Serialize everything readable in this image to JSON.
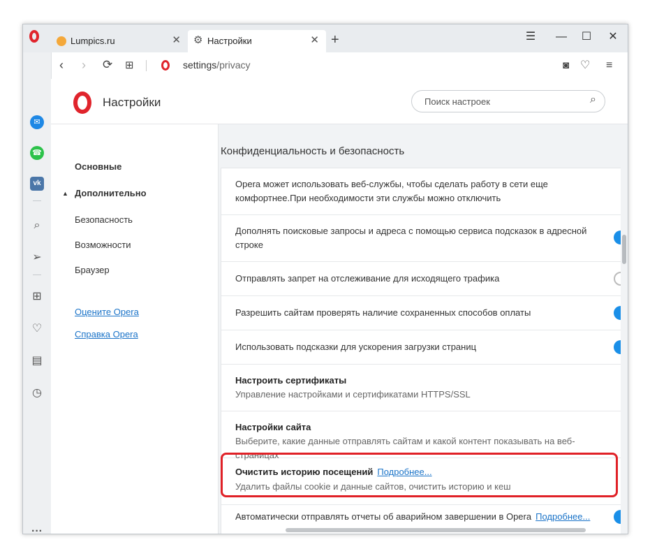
{
  "tabs": [
    {
      "label": "Lumpics.ru",
      "close": "✕"
    },
    {
      "label": "Настройки",
      "close": "✕"
    }
  ],
  "new_tab": "+",
  "window_controls": {
    "menu": "☰",
    "minimize": "—",
    "maximize": "☐",
    "close": "✕"
  },
  "address": {
    "host": "settings",
    "path": "/privacy"
  },
  "header": {
    "title": "Настройки",
    "search_placeholder": "Поиск настроек"
  },
  "leftnav": {
    "basic": "Основные",
    "advanced": "Дополнительно",
    "items": [
      "Безопасность",
      "Возможности",
      "Браузер"
    ],
    "links": [
      "Оцените Opera",
      "Справка Opera"
    ]
  },
  "section_title": "Конфиденциальность и безопасность",
  "rows": [
    {
      "text": "Opera может использовать веб-службы, чтобы сделать работу в сети еще комфортнее.При необходимости эти службы можно отключить"
    },
    {
      "text": "Дополнять поисковые запросы и адреса с помощью сервиса подсказок в адресной строке",
      "toggle": "on"
    },
    {
      "text": "Отправлять запрет на отслеживание для исходящего трафика",
      "toggle": "off"
    },
    {
      "text": "Разрешить сайтам проверять наличие сохраненных способов оплаты",
      "toggle": "on"
    },
    {
      "text": "Использовать подсказки для ускорения загрузки страниц",
      "toggle": "on"
    },
    {
      "title": "Настроить сертификаты",
      "sub": "Управление настройками и сертификатами HTTPS/SSL"
    },
    {
      "title": "Настройки сайта",
      "sub": "Выберите, какие данные отправлять сайтам и какой контент показывать на веб-страницах"
    },
    {
      "title": "Очистить историю посещений",
      "link": "Подробнее...",
      "sub": "Удалить файлы cookie и данные сайтов, очистить историю и кеш"
    },
    {
      "text": "Автоматически отправлять отчеты об аварийном завершении в Opera",
      "link": "Подробнее...",
      "toggle": "on"
    }
  ],
  "icons": {
    "sidebar": [
      "messenger-icon",
      "whatsapp-icon",
      "vk-icon",
      "search-icon",
      "send-icon",
      "speed-dial-icon",
      "heart-icon",
      "news-icon",
      "history-icon",
      "more-icon"
    ]
  },
  "sidebar_glyphs": {
    "vk": "vk",
    "more": "···"
  }
}
